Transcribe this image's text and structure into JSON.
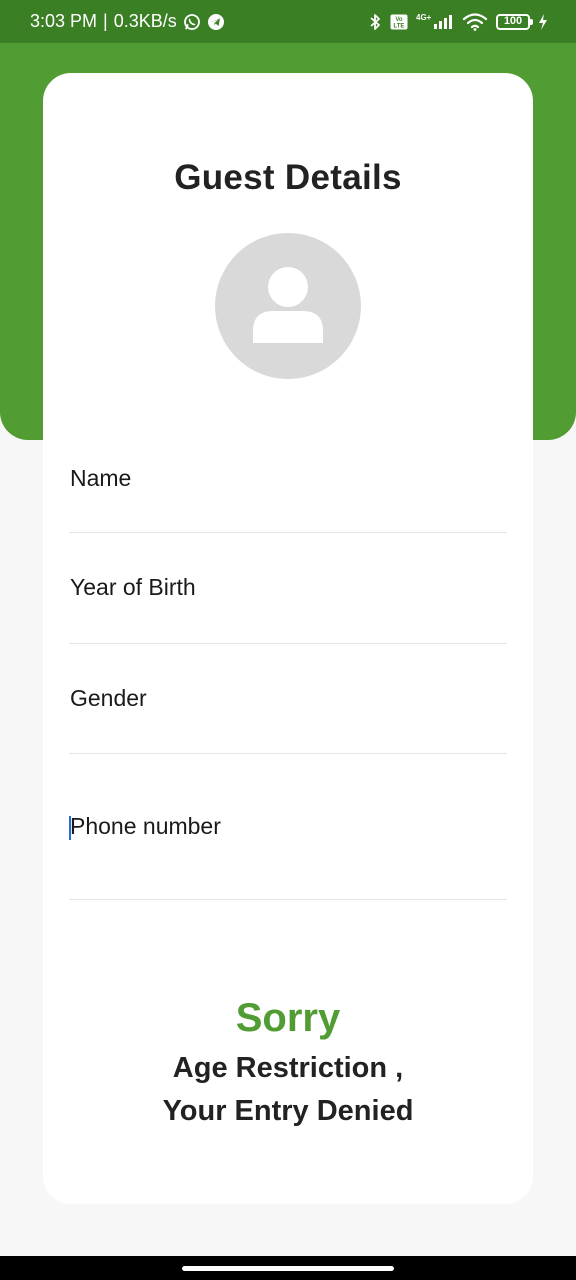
{
  "status_bar": {
    "time": "3:03 PM",
    "separator": "|",
    "speed": "0.3KB/s",
    "left_icons": [
      "whatsapp-icon",
      "telegram-icon"
    ],
    "right_icons": [
      "bluetooth-icon",
      "volte-icon",
      "signal-4g-icon",
      "wifi-icon",
      "battery-icon",
      "charging-icon"
    ],
    "network": "4G+",
    "volte": "Vo LTE",
    "battery": "100"
  },
  "colors": {
    "status_bar": "#3b7f25",
    "header_green": "#519c33",
    "accent_green": "#519c33",
    "background": "#f7f7f7",
    "card": "#ffffff",
    "avatar_bg": "#d9d9d9",
    "text_dark": "#222222",
    "cursor": "#1e6fd9"
  },
  "header": {
    "title": "Guest Details",
    "avatar_icon": "user-icon"
  },
  "form": {
    "fields": [
      {
        "label": "Name"
      },
      {
        "label": "Year of Birth"
      },
      {
        "label": "Gender"
      },
      {
        "label": "Phone number"
      }
    ]
  },
  "message": {
    "title": "Sorry",
    "line1": "Age Restriction ,",
    "line2": "Your Entry Denied"
  }
}
